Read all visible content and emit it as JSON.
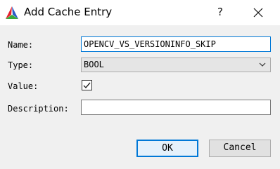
{
  "window": {
    "title": "Add Cache Entry",
    "help_glyph": "?"
  },
  "form": {
    "name_label": "Name:",
    "name_value": "OPENCV_VS_VERSIONINFO_SKIP",
    "type_label": "Type:",
    "type_value": "BOOL",
    "value_label": "Value:",
    "value_checked": true,
    "description_label": "Description:",
    "description_value": ""
  },
  "buttons": {
    "ok": "OK",
    "cancel": "Cancel"
  },
  "colors": {
    "accent": "#0078d7",
    "icon_red": "#e8202e",
    "icon_green": "#3aa93a",
    "icon_blue": "#2a5cc8"
  }
}
